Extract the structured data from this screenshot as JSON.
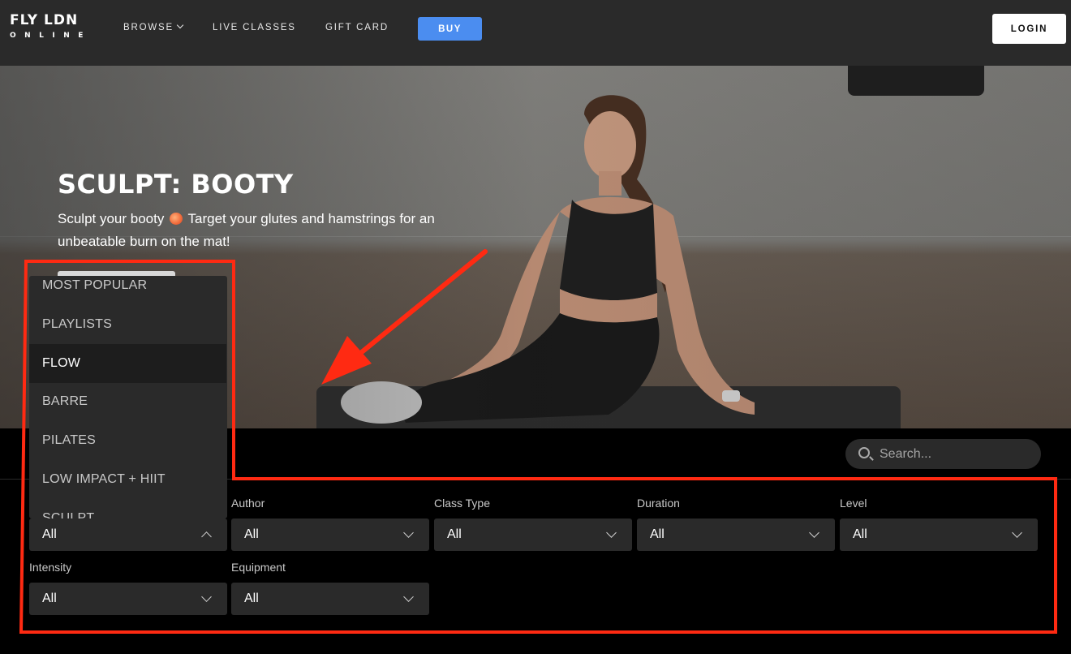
{
  "nav": {
    "logo_top": "FLY LDN",
    "logo_bottom": "ONLINE",
    "links": [
      {
        "label": "BROWSE"
      },
      {
        "label": "LIVE CLASSES"
      },
      {
        "label": "GIFT CARD"
      }
    ],
    "buy_label": "BUY",
    "login_label": "LOGIN"
  },
  "hero": {
    "title": "SCULPT: BOOTY",
    "desc_part1": "Sculpt your booty",
    "desc_part2": "Target your glutes and hamstrings for an unbeatable burn on the mat!"
  },
  "search": {
    "placeholder": "Search..."
  },
  "category_menu": {
    "items": [
      "MOST POPULAR",
      "PLAYLISTS",
      "FLOW",
      "BARRE",
      "PILATES",
      "LOW IMPACT + HIIT",
      "SCULPT"
    ],
    "highlighted": "FLOW",
    "selected_value": "All"
  },
  "filters": [
    {
      "label": "Author",
      "value": "All"
    },
    {
      "label": "Class Type",
      "value": "All"
    },
    {
      "label": "Duration",
      "value": "All"
    },
    {
      "label": "Level",
      "value": "All"
    },
    {
      "label": "Intensity",
      "value": "All"
    },
    {
      "label": "Equipment",
      "value": "All"
    }
  ],
  "colors": {
    "accent_blue": "#4b8df0",
    "annotation_red": "#ff2a12",
    "nav_bg": "#2a2a2a"
  }
}
